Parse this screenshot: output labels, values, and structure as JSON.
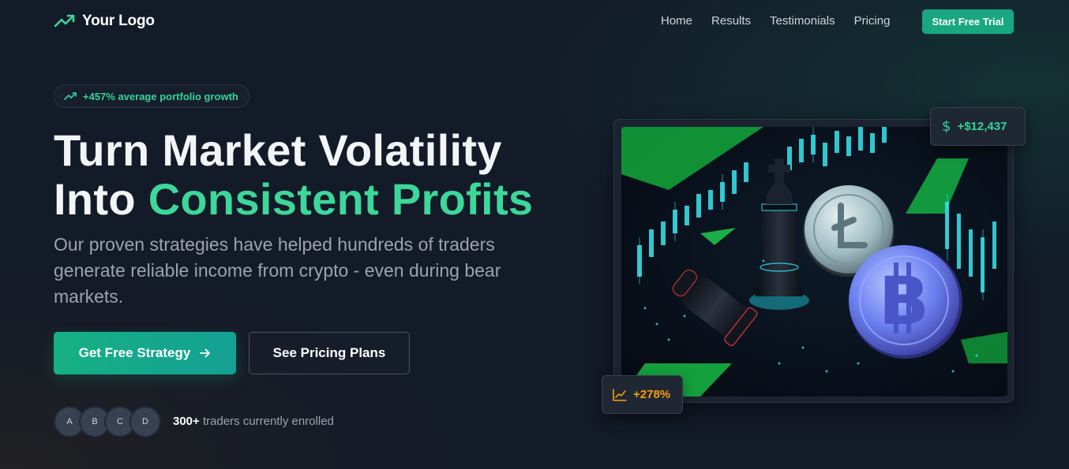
{
  "brand": {
    "name": "Your Logo",
    "accent": "#3dd79a",
    "primary_button": "#19a77f"
  },
  "nav": {
    "links": [
      "Home",
      "Results",
      "Testimonials",
      "Pricing"
    ],
    "cta": "Start Free Trial"
  },
  "hero": {
    "badge": "+457% average portfolio growth",
    "headline_line1": "Turn Market Volatility",
    "headline_line2_prefix": "Into ",
    "headline_line2_accent": "Consistent Profits",
    "subtext": "Our proven strategies have helped hundreds of traders generate reliable income from crypto - even during bear markets.",
    "primary_button": "Get Free Strategy",
    "primary_button_icon": "arrow-right-icon",
    "secondary_button": "See Pricing Plans",
    "avatars": [
      "A",
      "B",
      "C",
      "D"
    ],
    "enrolled_count": "300+",
    "enrolled_text": "traders currently enrolled"
  },
  "stats": {
    "top_icon": "dollar-icon",
    "top_value": "+$12,437",
    "bottom_icon": "line-chart-icon",
    "bottom_value": "+278%"
  }
}
